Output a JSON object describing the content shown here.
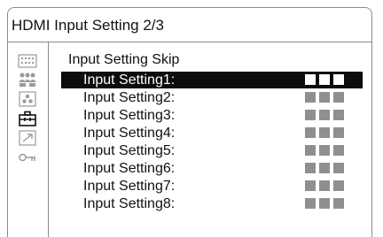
{
  "window": {
    "title": "HDMI Input Setting 2/3"
  },
  "menu": {
    "heading": "Input Setting Skip",
    "items": [
      {
        "label": "Input Setting1:",
        "selected": true
      },
      {
        "label": "Input Setting2:",
        "selected": false
      },
      {
        "label": "Input Setting3:",
        "selected": false
      },
      {
        "label": "Input Setting4:",
        "selected": false
      },
      {
        "label": "Input Setting5:",
        "selected": false
      },
      {
        "label": "Input Setting6:",
        "selected": false
      },
      {
        "label": "Input Setting7:",
        "selected": false
      },
      {
        "label": "Input Setting8:",
        "selected": false
      }
    ]
  },
  "sidebar": {
    "icons": [
      {
        "name": "picture-settings-icon",
        "active": false
      },
      {
        "name": "people-icon",
        "active": false
      },
      {
        "name": "audio-icon",
        "active": false
      },
      {
        "name": "toolbox-icon",
        "active": true
      },
      {
        "name": "export-icon",
        "active": false
      },
      {
        "name": "key-icon",
        "active": false
      }
    ]
  },
  "colors": {
    "selection_bg": "#0c0c0c",
    "selected_square": "#ffffff",
    "square": "#8f8f8f",
    "border": "#8a8a8a",
    "icon_inactive": "#9a9a9a",
    "icon_active": "#111111"
  }
}
